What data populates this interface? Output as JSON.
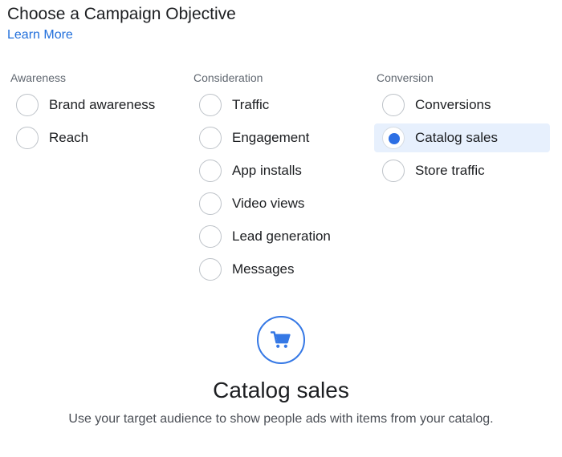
{
  "header": {
    "title": "Choose a Campaign Objective",
    "learn_more": "Learn More"
  },
  "columns": [
    {
      "heading": "Awareness",
      "options": [
        {
          "label": "Brand awareness",
          "selected": false
        },
        {
          "label": "Reach",
          "selected": false
        }
      ]
    },
    {
      "heading": "Consideration",
      "options": [
        {
          "label": "Traffic",
          "selected": false
        },
        {
          "label": "Engagement",
          "selected": false
        },
        {
          "label": "App installs",
          "selected": false
        },
        {
          "label": "Video views",
          "selected": false
        },
        {
          "label": "Lead generation",
          "selected": false
        },
        {
          "label": "Messages",
          "selected": false
        }
      ]
    },
    {
      "heading": "Conversion",
      "options": [
        {
          "label": "Conversions",
          "selected": false
        },
        {
          "label": "Catalog sales",
          "selected": true
        },
        {
          "label": "Store traffic",
          "selected": false
        }
      ]
    }
  ],
  "detail": {
    "icon": "shopping-cart-icon",
    "title": "Catalog sales",
    "description": "Use your target audience to show people ads with items from your catalog."
  },
  "colors": {
    "accent": "#3578e5",
    "link": "#216fdb",
    "selected_bg": "#e7f0fd",
    "radio_border": "#bec3c9"
  }
}
